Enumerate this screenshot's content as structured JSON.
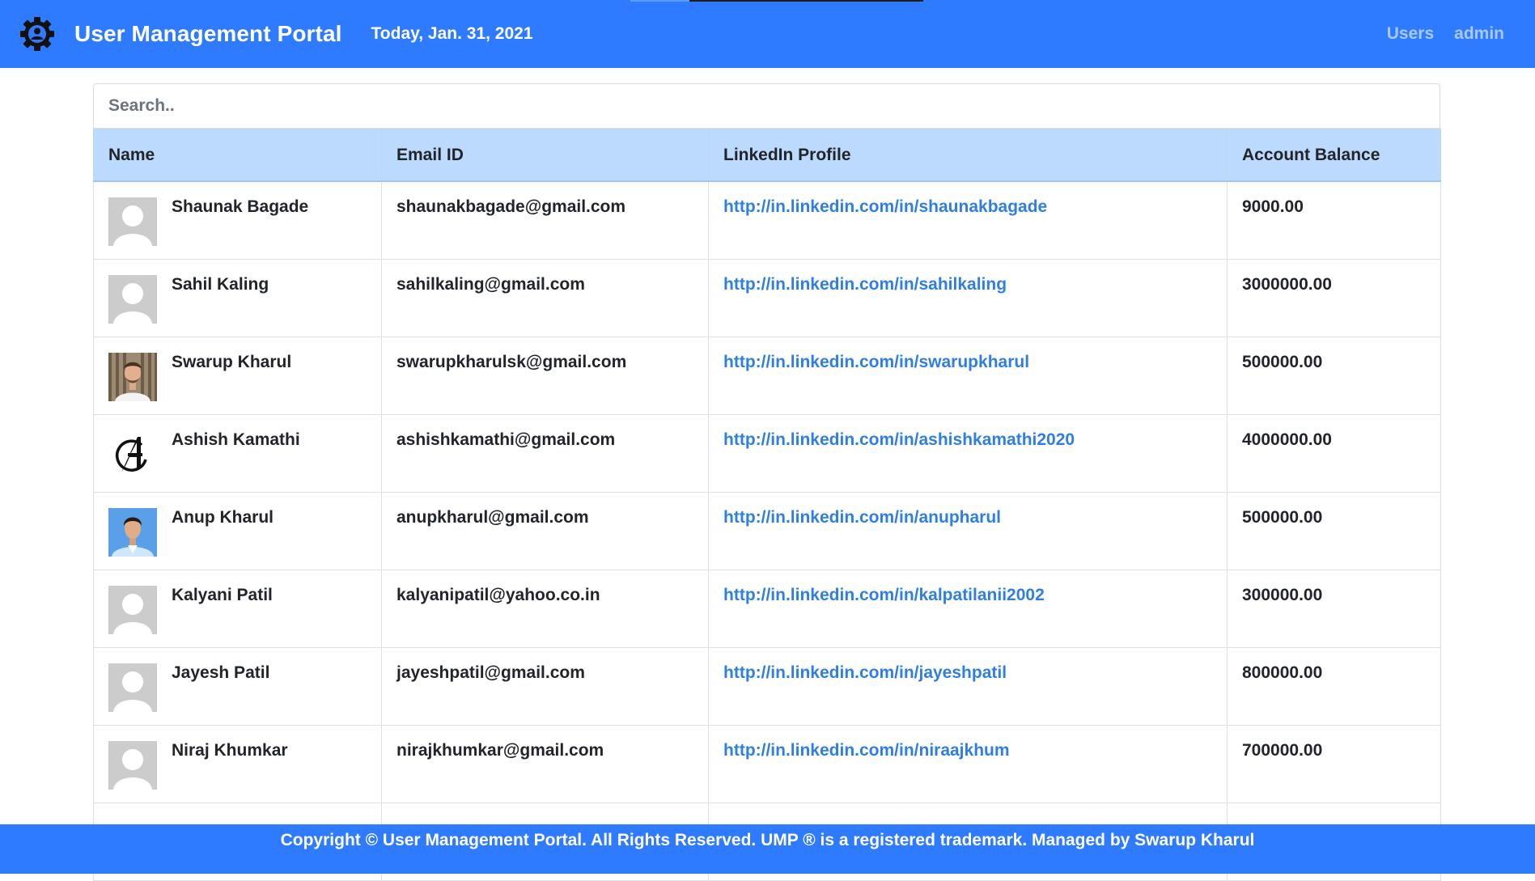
{
  "header": {
    "brand": "User Management Portal",
    "date": "Today, Jan. 31, 2021",
    "nav": [
      "Users",
      "admin"
    ],
    "logo_icon": "gear-user-icon"
  },
  "search": {
    "placeholder": "Search.."
  },
  "table": {
    "columns": [
      "Name",
      "Email ID",
      "LinkedIn Profile",
      "Account Balance"
    ],
    "rows": [
      {
        "name": "Shaunak Bagade",
        "email": "shaunakbagade@gmail.com",
        "linkedin": "http://in.linkedin.com/in/shaunakbagade",
        "balance": "9000.00",
        "avatar": "default-avatar-icon"
      },
      {
        "name": "Sahil Kaling",
        "email": "sahilkaling@gmail.com",
        "linkedin": "http://in.linkedin.com/in/sahilkaling",
        "balance": "3000000.00",
        "avatar": "default-avatar-icon"
      },
      {
        "name": "Swarup Kharul",
        "email": "swarupkharulsk@gmail.com",
        "linkedin": "http://in.linkedin.com/in/swarupkharul",
        "balance": "500000.00",
        "avatar": "photo-avatar"
      },
      {
        "name": "Ashish Kamathi",
        "email": "ashishkamathi@gmail.com",
        "linkedin": "http://in.linkedin.com/in/ashishkamathi2020",
        "balance": "4000000.00",
        "avatar": "avengers-logo-avatar"
      },
      {
        "name": "Anup Kharul",
        "email": "anupkharul@gmail.com",
        "linkedin": "http://in.linkedin.com/in/anupharul",
        "balance": "500000.00",
        "avatar": "photo-avatar"
      },
      {
        "name": "Kalyani Patil",
        "email": "kalyanipatil@yahoo.co.in",
        "linkedin": "http://in.linkedin.com/in/kalpatilanii2002",
        "balance": "300000.00",
        "avatar": "default-avatar-icon"
      },
      {
        "name": "Jayesh Patil",
        "email": "jayeshpatil@gmail.com",
        "linkedin": "http://in.linkedin.com/in/jayeshpatil",
        "balance": "800000.00",
        "avatar": "default-avatar-icon"
      },
      {
        "name": "Niraj Khumkar",
        "email": "nirajkhumkar@gmail.com",
        "linkedin": "http://in.linkedin.com/in/niraajkhum",
        "balance": "700000.00",
        "avatar": "default-avatar-icon"
      }
    ]
  },
  "footer": {
    "text": "Copyright © User Management Portal. All Rights Reserved. UMP ® is a registered trademark. Managed by Swarup Kharul"
  },
  "colors": {
    "primary": "#2f7bff",
    "header_row": "#bbdafe",
    "link": "#2f7fe0",
    "nav_link": "#a9c8ff"
  }
}
